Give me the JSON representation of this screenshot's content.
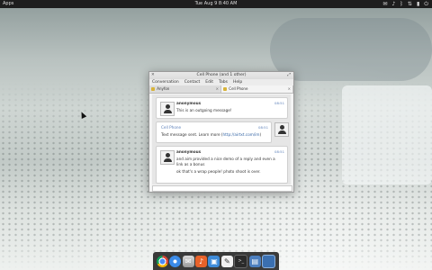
{
  "topbar": {
    "apps_label": "Apps",
    "clock": "Tue Aug 9 8:40 AM",
    "tray_icons": [
      "mail-icon",
      "volume-icon",
      "bluetooth-icon",
      "network-icon",
      "battery-icon",
      "power-icon"
    ]
  },
  "window": {
    "title": "Cell Phone (and 1 other)",
    "menu": [
      "Conversation",
      "Contact",
      "Edit",
      "Tabs",
      "Help"
    ],
    "tabs": [
      {
        "label": "Anyfon",
        "active": false
      },
      {
        "label": "Cell Phone",
        "active": true
      }
    ],
    "messages": [
      {
        "sender": "anonymous",
        "time": "08:51",
        "text": "This is an outgoing message!"
      },
      {
        "sender": "Cell Phone",
        "time": "08:51",
        "text": "Text message sent. Learn more (",
        "link": "http://airtxt.com/im",
        "text_after": ")"
      },
      {
        "sender": "anonymous",
        "time": "08:51",
        "text": "and aim provided a nice demo of a reply and even a link as a bonus",
        "text2": "ok that's a wrap people! photo shoot is over."
      }
    ]
  },
  "dock": {
    "apps": [
      "chrome-icon",
      "safari-icon",
      "mail-icon",
      "music-icon",
      "photo-icon",
      "text-editor-icon",
      "terminal-icon",
      "files-icon",
      "display-icon"
    ]
  }
}
